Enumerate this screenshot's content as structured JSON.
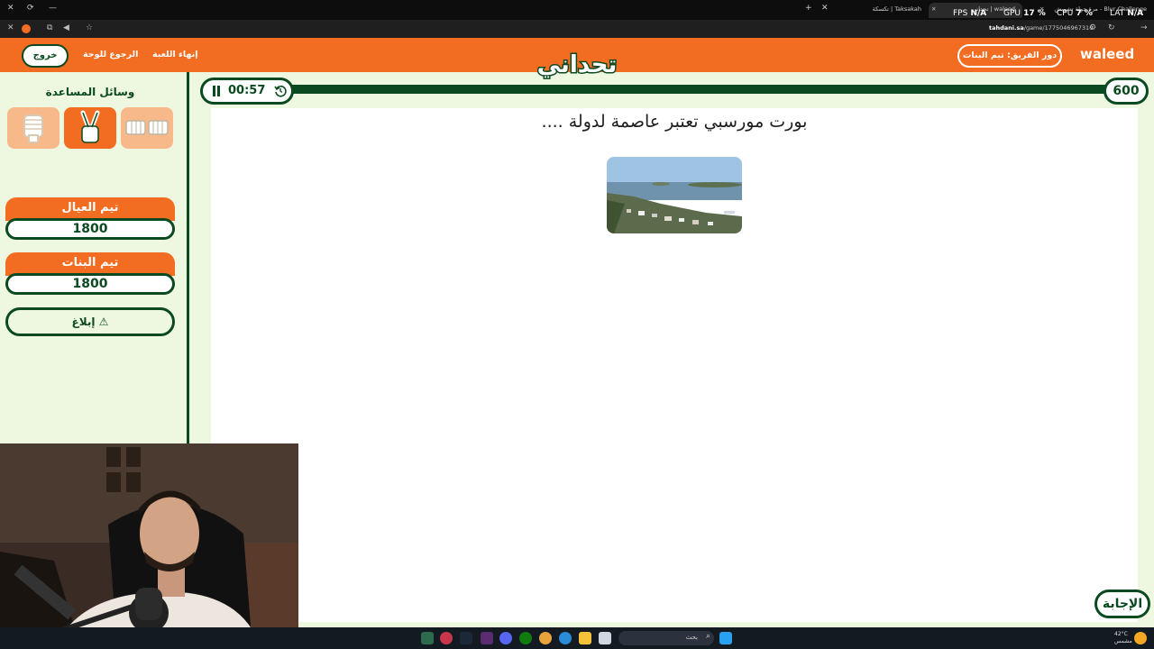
{
  "browser": {
    "tabs": [
      {
        "label": "Taksakah | تكسكة"
      },
      {
        "label": "waleed | تحداني"
      },
      {
        "label": "Blur Challenge - مرة جولة تشويش"
      }
    ],
    "url_domain": "tahdani.sa",
    "url_path": "/game/1775046967310",
    "hud": {
      "fps_label": "FPS",
      "fps": "N/A",
      "gpu_label": "GPU",
      "gpu": "17 %",
      "cpu_label": "CPU",
      "cpu": "7 %",
      "lat_label": "LAT",
      "lat": "N/A"
    }
  },
  "header": {
    "exit_label": "خروج",
    "back_label": "الرجوع للوحة",
    "end_game_label": "إنهاء اللعبة",
    "logo_text": "تحداني",
    "turn_label": "دور الفريق: تيم البنات",
    "player_name": "waleed"
  },
  "sidebar": {
    "aids_title": "وسائل المساعدة",
    "teams": [
      {
        "name": "تيم العيال",
        "score": "1800"
      },
      {
        "name": "تيم البنات",
        "score": "1800"
      }
    ],
    "report_label": "إبلاغ",
    "report_icon": "⚠"
  },
  "question": {
    "timer": "00:57",
    "points": "600",
    "text": "بورت مورسبي تعتبر عاصمة لدولة ....",
    "answer_label": "الإجابة"
  },
  "taskbar": {
    "search_placeholder": "بحث",
    "weather": "42°C",
    "weather_sub": "مشمس"
  },
  "colors": {
    "orange": "#f26d21",
    "green": "#0b4a20",
    "bg": "#eef8e0"
  }
}
